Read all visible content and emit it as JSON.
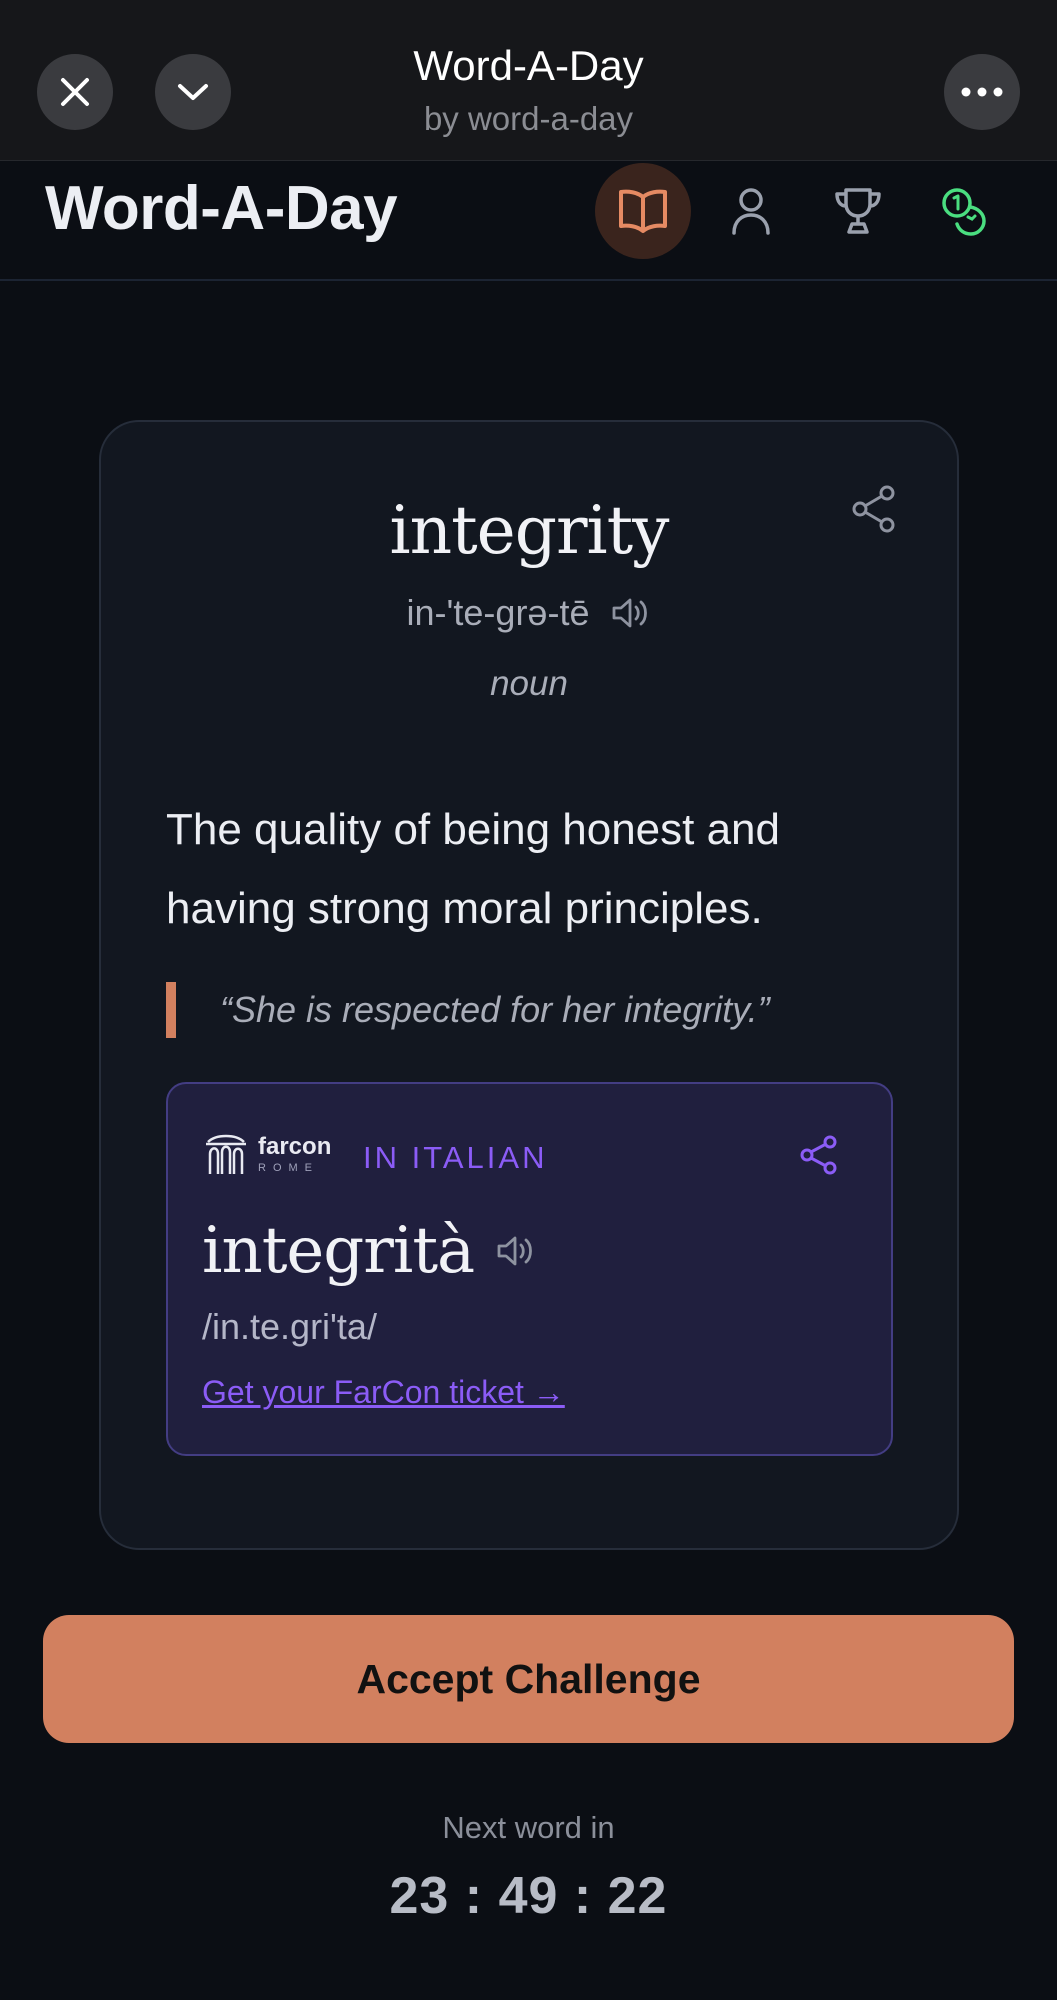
{
  "topbar": {
    "title": "Word-A-Day",
    "subtitle": "by word-a-day",
    "close_icon": "close-icon",
    "collapse_icon": "chevron-down-icon",
    "more_icon": "more-horizontal-icon"
  },
  "header": {
    "logo": "Word-A-Day",
    "nav": [
      {
        "icon": "book-icon",
        "active": true
      },
      {
        "icon": "user-icon",
        "active": false
      },
      {
        "icon": "trophy-icon",
        "active": false
      },
      {
        "icon": "coins-icon",
        "active": false
      }
    ]
  },
  "word_card": {
    "word": "integrity",
    "pronunciation": "in-'te-grə-tē",
    "part_of_speech": "noun",
    "definition": "The quality of being honest and having strong moral principles.",
    "example": "“She is respected for her integrity.”"
  },
  "translation": {
    "sponsor_name": "farcon",
    "sponsor_city": "ROME",
    "label": "IN ITALIAN",
    "word": "integrità",
    "pronunciation": "/in.te.gri'ta/",
    "link_text": "Get your FarCon ticket →"
  },
  "cta": {
    "label": "Accept Challenge"
  },
  "countdown": {
    "label": "Next word in",
    "time": "23 : 49 : 22"
  },
  "colors": {
    "accent": "#d2805f",
    "purple": "#8b5cf6",
    "background": "#0b0e14",
    "card": "#121720",
    "coins_green": "#4ade80"
  }
}
